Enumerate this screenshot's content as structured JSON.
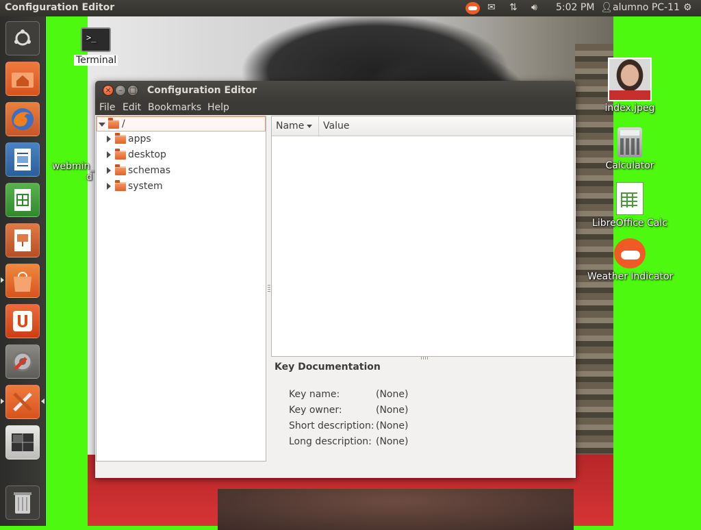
{
  "top_panel": {
    "app_title": "Configuration Editor",
    "clock": "5:02 PM",
    "user": "alumno PC-11",
    "icons": [
      "weather-indicator-icon",
      "mail-icon",
      "network-icon",
      "volume-icon",
      "user-icon",
      "settings-gear-icon"
    ]
  },
  "launcher": {
    "items": [
      {
        "name": "dash-home",
        "color": "#3a3a37"
      },
      {
        "name": "files",
        "color": "#e2622a"
      },
      {
        "name": "firefox",
        "color": "#e5742b"
      },
      {
        "name": "libreoffice-writer",
        "color": "#2f6aa8"
      },
      {
        "name": "libreoffice-calc",
        "color": "#3c9b3b"
      },
      {
        "name": "libreoffice-impress",
        "color": "#c8562a"
      },
      {
        "name": "software-center",
        "color": "#e2622a"
      },
      {
        "name": "ubuntu-one",
        "color": "#dd4814"
      },
      {
        "name": "system-settings",
        "color": "#c83c3c"
      },
      {
        "name": "configuration-tools",
        "color": "#e2622a"
      },
      {
        "name": "workspace-switcher",
        "color": "#555"
      },
      {
        "name": "trash",
        "color": "#3a3a37"
      }
    ]
  },
  "desktop": {
    "terminal_label": "Terminal",
    "webmin_label": "webmin_",
    "webmin_label2": "d",
    "index_label": "index.jpeg",
    "calculator_label": "Calculator",
    "calc_label": "LibreOffice Calc",
    "weather_label": "Weather Indicator"
  },
  "window": {
    "title": "Configuration Editor",
    "menu": [
      "File",
      "Edit",
      "Bookmarks",
      "Help"
    ],
    "tree": {
      "root": "/",
      "children": [
        "apps",
        "desktop",
        "schemas",
        "system"
      ]
    },
    "list": {
      "col_name": "Name",
      "col_value": "Value"
    },
    "doc": {
      "title": "Key Documentation",
      "rows": [
        {
          "label": "Key name:",
          "value": "(None)"
        },
        {
          "label": "Key owner:",
          "value": "(None)"
        },
        {
          "label": "Short description:",
          "value": "(None)"
        },
        {
          "label": "Long description:",
          "value": "(None)"
        }
      ]
    }
  },
  "colors": {
    "desktop_bg": "#4cf90f",
    "panel_bg": "#3c3b37",
    "accent": "#dd4814"
  }
}
